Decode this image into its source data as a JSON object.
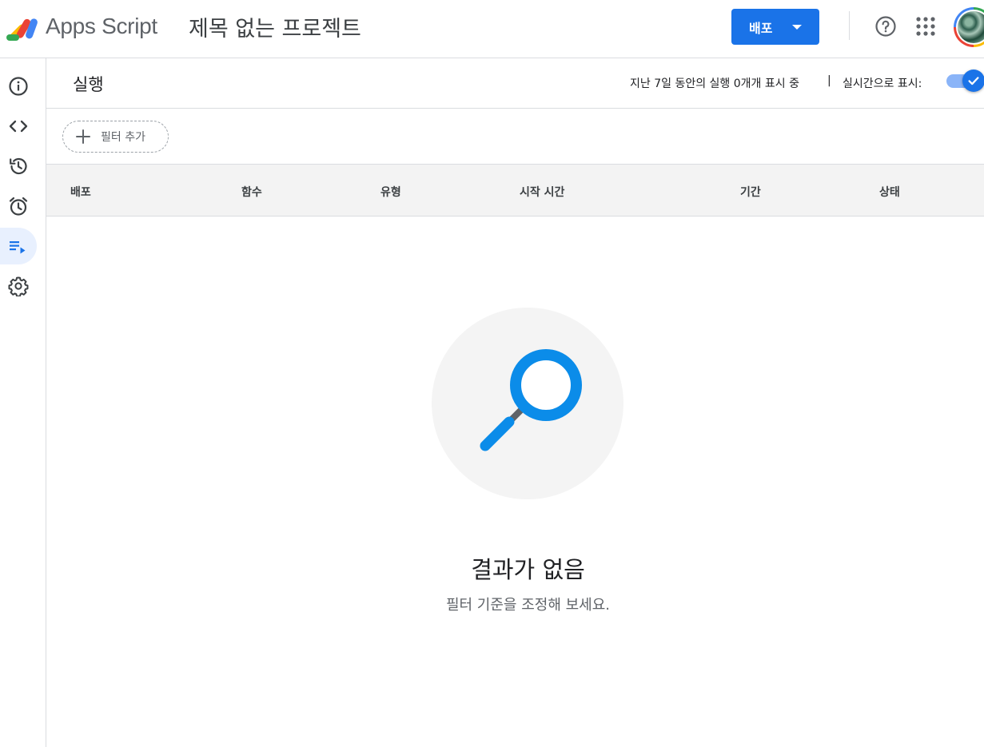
{
  "header": {
    "app_name": "Apps Script",
    "project_title": "제목 없는 프로젝트",
    "deploy_label": "배포",
    "help_icon": "help-circle-icon",
    "apps_icon": "grid-apps-icon"
  },
  "sidebar": {
    "items": [
      {
        "id": "overview",
        "icon": "info-icon"
      },
      {
        "id": "editor",
        "icon": "code-icon"
      },
      {
        "id": "history",
        "icon": "history-icon"
      },
      {
        "id": "triggers",
        "icon": "alarm-icon"
      },
      {
        "id": "executions",
        "icon": "executions-icon",
        "active": true
      },
      {
        "id": "settings",
        "icon": "gear-icon"
      }
    ]
  },
  "page": {
    "title": "실행",
    "summary": "지난 7일 동안의 실행 0개개 표시 중",
    "separator": "|",
    "realtime_label": "실시간으로 표시:",
    "realtime_on": true
  },
  "filter": {
    "add_label": "필터 추가"
  },
  "table": {
    "columns": [
      "배포",
      "함수",
      "유형",
      "시작 시간",
      "기간",
      "상태"
    ]
  },
  "empty_state": {
    "title": "결과가 없음",
    "subtitle": "필터 기준을 조정해 보세요."
  },
  "colors": {
    "accent": "#1a73e8",
    "magnifier": "#0b8ce9",
    "active_rail": "#e8f0fe"
  }
}
